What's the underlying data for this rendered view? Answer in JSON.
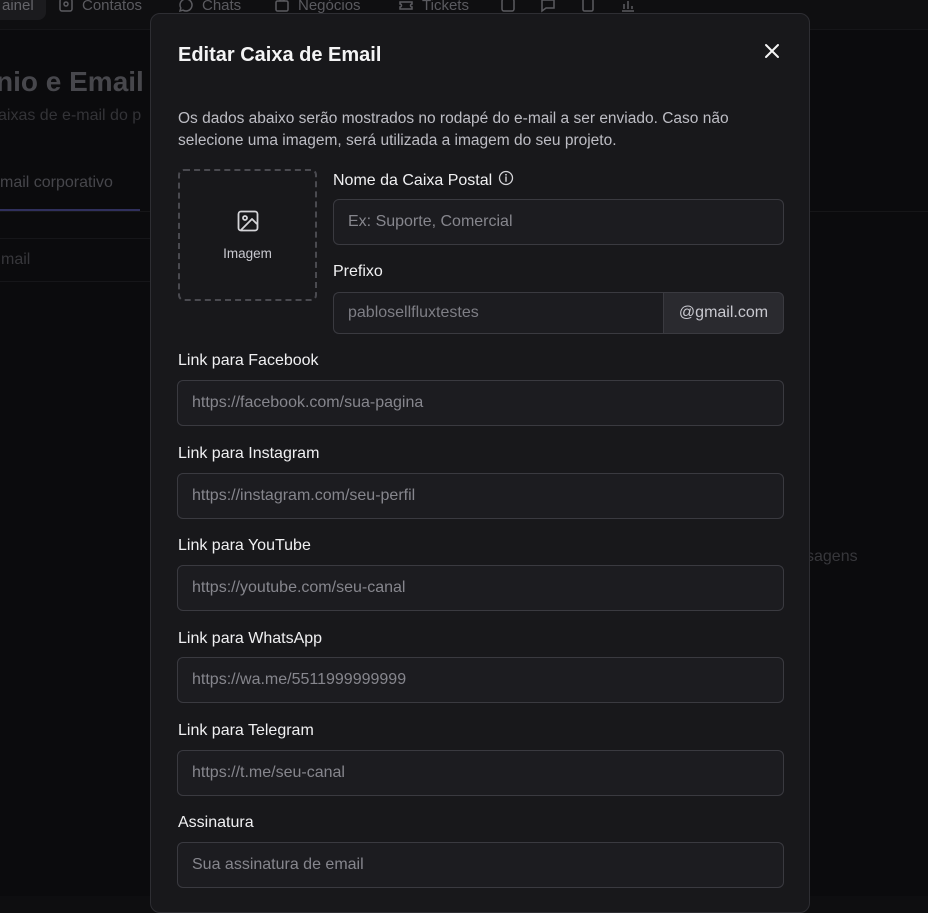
{
  "nav": {
    "items": [
      {
        "label": "ainel",
        "icon": "dashboard-icon"
      },
      {
        "label": "Contatos",
        "icon": "contacts-icon"
      },
      {
        "label": "Chats",
        "icon": "chat-icon"
      },
      {
        "label": "Negócios",
        "icon": "briefcase-icon"
      },
      {
        "label": "Tickets",
        "icon": "ticket-icon"
      }
    ]
  },
  "background": {
    "title": "nio e Email B",
    "subtitle": "aixas de e-mail do p",
    "tab": "mail corporativo",
    "search_placeholder": "mail",
    "right_text": "sagens"
  },
  "modal": {
    "title": "Editar Caixa de Email",
    "description": "Os dados abaixo serão mostrados no rodapé do e-mail a ser enviado. Caso não selecione uma imagem, será utilizada a imagem do seu projeto.",
    "image_label": "Imagem",
    "fields": {
      "mailbox_name": {
        "label": "Nome da Caixa Postal",
        "placeholder": "Ex: Suporte, Comercial",
        "value": ""
      },
      "prefix": {
        "label": "Prefixo",
        "placeholder": "pablosellfluxtestes",
        "suffix": "@gmail.com"
      },
      "facebook": {
        "label": "Link para Facebook",
        "placeholder": "https://facebook.com/sua-pagina"
      },
      "instagram": {
        "label": "Link para Instagram",
        "placeholder": "https://instagram.com/seu-perfil"
      },
      "youtube": {
        "label": "Link para YouTube",
        "placeholder": "https://youtube.com/seu-canal"
      },
      "whatsapp": {
        "label": "Link para WhatsApp",
        "placeholder": "https://wa.me/5511999999999"
      },
      "telegram": {
        "label": "Link para Telegram",
        "placeholder": "https://t.me/seu-canal"
      },
      "signature": {
        "label": "Assinatura",
        "placeholder": "Sua assinatura de email"
      }
    }
  }
}
